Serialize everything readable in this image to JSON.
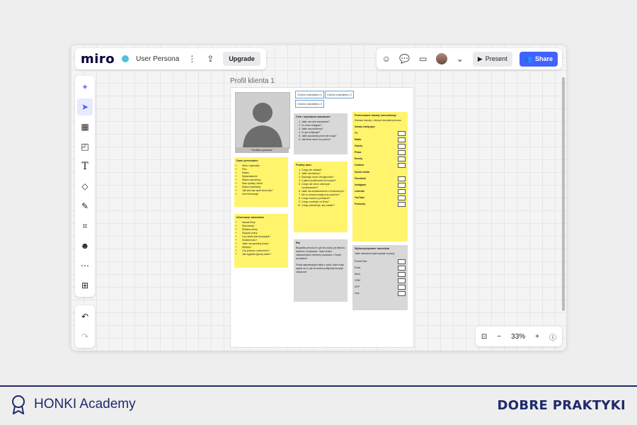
{
  "app": {
    "logo": "miro",
    "board_name": "User Persona",
    "upgrade_label": "Upgrade",
    "present_label": "Present",
    "share_label": "Share",
    "zoom_level": "33%",
    "accent": "#4262ff"
  },
  "toolbar": {
    "tools": [
      "ai-sparkle-icon",
      "select-cursor-icon",
      "templates-icon",
      "sticky-note-icon",
      "text-icon",
      "shapes-icon",
      "pen-icon",
      "frame-icon",
      "stickers-icon",
      "comment-icon",
      "add-icon"
    ],
    "history": [
      "undo-icon",
      "redo-icon"
    ]
  },
  "frame": {
    "label": "Profil klienta 1",
    "photo_caption": "\"Grafika zyciowe\"",
    "tags": [
      "Cecha charakteru 1",
      "Cecha charakteru 2",
      "Cecha charakteru 3"
    ],
    "notes": {
      "personal": {
        "title": "Dane personalne",
        "items": [
          "Wiek / wyksztalc",
          "Plec",
          "Miasto",
          "Wyksztalcenie",
          "Status zawodowy",
          "Stan cywilny, dzieci",
          "Status materialny",
          "Jaki jest styl zycia tej osoby?",
          "Inne informacje"
        ]
      },
      "info": {
        "title": "Informacje zawodowe",
        "items": [
          "Nazwa firmy",
          "Stanowisko",
          "Wielkosc firmy",
          "Dlugosc pracy",
          "Czy osoba jest decyzyjna?",
          "Swiadomosc?",
          "Jakie ma sposoby pracy?",
          "Wplywy?",
          "Czy pracuje z partnerem?",
          "Jak wyglada typowy dzien?"
        ]
      },
      "goals": {
        "title": "Cele i wyzwania zawodowe",
        "items": [
          "Jakie ma cele zawodowe?",
          "Co chce osiagnac?",
          "Jakie ma problemy?",
          "Co go motywuje?",
          "Jakie wyzwania przed nim stoja?",
          "Jak firma moze mu pomoc?"
        ]
      },
      "pain": {
        "title": "Punkty bolu",
        "items": [
          "Czego sie obawia?",
          "Jakie ma bariery?",
          "Dlaczego moze zrezygnowac?",
          "Z jakimi problemami sie boryka?",
          "Czego nie lubi w obecnych rozwiazaniach?",
          "Jakie ma doswiadczenia z konkurencja?",
          "Na co zwraca uwage przy wyborze?",
          "Czego szuka w produkcie?",
          "Czego oczekuje od firmy?",
          "Czego potrzebuje, aby zaufac?"
        ]
      },
      "bio": {
        "title": "Bio",
        "text1": "Biografia persony to opis tej osoby, jej historia, wartosci, motywacje. Opisz krotko najwazniejsze elementy zwiazane z Twoim produktem.",
        "text2": "Podaj najwazniejsze fakty z zycia, ktore maja wplyw na to, jak ta osoba podejmuje decyzje zakupowe."
      },
      "channels": {
        "title": "Preferowane kanaly komunikacji",
        "subtitle": "Zaznacz kanaly, z ktorych korzysta persona",
        "traditional_label": "Kanaly tradycyjne",
        "traditional": [
          "TV",
          "Radio",
          "Gazety",
          "Prasa",
          "Eventy",
          "Outdoor"
        ],
        "social_label": "Social media",
        "social": [
          "Facebook",
          "Instagram",
          "LinkedIn",
          "YouTube",
          "Podcasty"
        ]
      },
      "tools": {
        "title": "Wykorzystywane narzedzia",
        "subtitle": "Jakie narzedzia wykorzystuje w pracy",
        "items": [
          "PowerPoint",
          "Excel",
          "Word",
          "CRM",
          "ERP",
          "Inne"
        ]
      }
    }
  },
  "footer": {
    "brand": "HONKI Academy",
    "tagline": "DOBRE PRAKTYKI"
  }
}
